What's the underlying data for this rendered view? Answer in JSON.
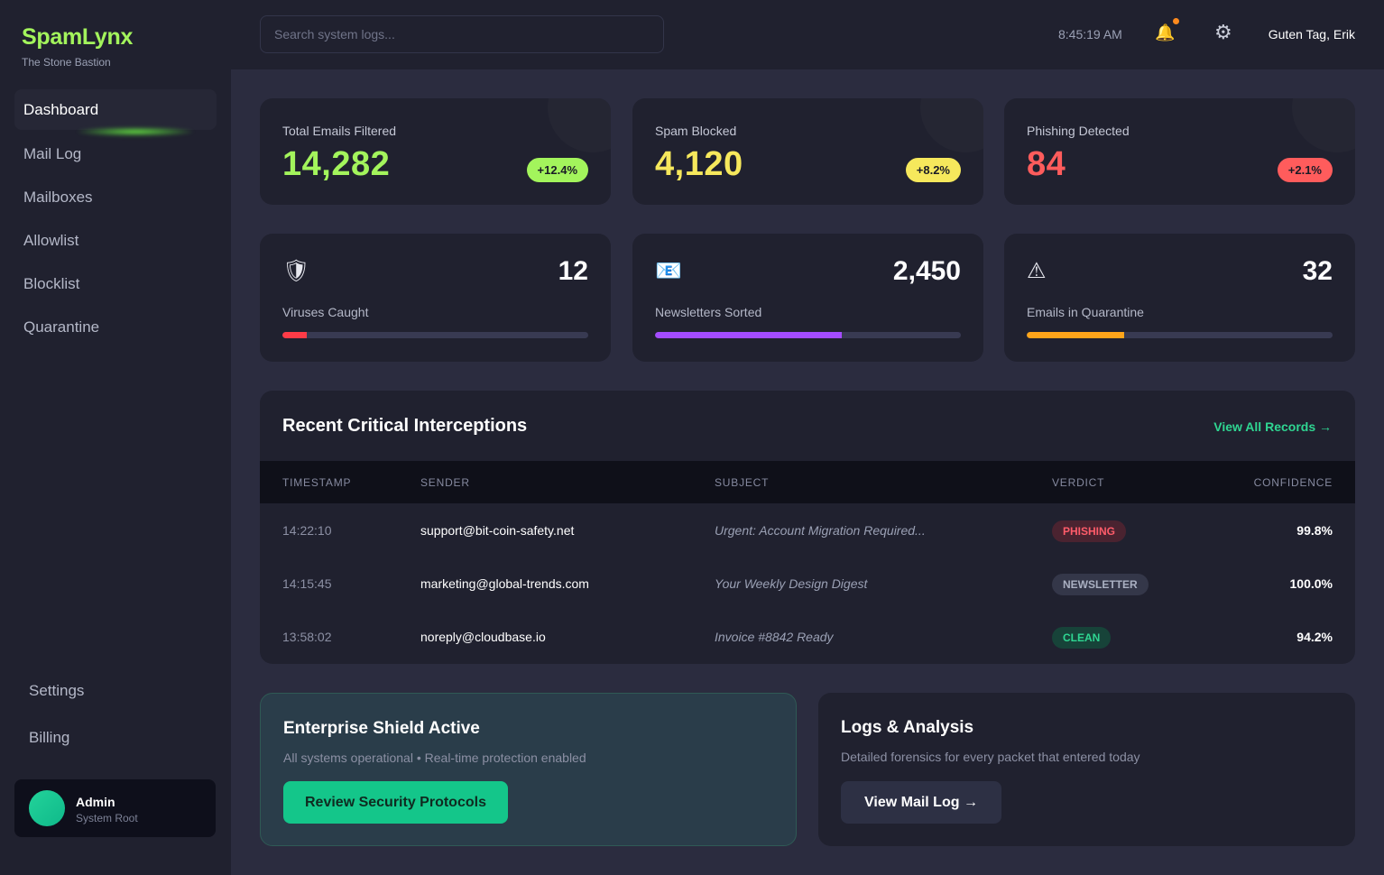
{
  "brand": {
    "name": "SpamLynx",
    "subtitle": "The Stone Bastion"
  },
  "nav": {
    "items": [
      "Dashboard",
      "Mail Log",
      "Mailboxes",
      "Allowlist",
      "Blocklist",
      "Quarantine"
    ],
    "active": "Dashboard",
    "bottom": [
      "Settings",
      "Billing"
    ]
  },
  "user": {
    "name": "Admin",
    "role": "System Root"
  },
  "topbar": {
    "search_placeholder": "Search system logs...",
    "time": "8:45:19 AM",
    "bell_icon": "🔔",
    "gear_icon": "⚙",
    "greeting": "Guten Tag, Erik"
  },
  "stats": [
    {
      "label": "Total Emails Filtered",
      "value": "14,282",
      "badge": "+12.4%",
      "color": "#a3f45c"
    },
    {
      "label": "Spam Blocked",
      "value": "4,120",
      "badge": "+8.2%",
      "color": "#f6e85c"
    },
    {
      "label": "Phishing Detected",
      "value": "84",
      "badge": "+2.1%",
      "color": "#ff5c5c"
    }
  ],
  "mini_stats": [
    {
      "icon": "🛡",
      "icon_name": "shield-icon",
      "value": "12",
      "label": "Viruses Caught",
      "progress": 0.08,
      "color": "#ff3b47"
    },
    {
      "icon": "📧",
      "icon_name": "envelope-icon",
      "value": "2,450",
      "label": "Newsletters Sorted",
      "progress": 0.61,
      "color": "#a44cff"
    },
    {
      "icon": "⚠",
      "icon_name": "warning-icon",
      "value": "32",
      "label": "Emails in Quarantine",
      "progress": 0.32,
      "color": "#ffa51a"
    }
  ],
  "interceptions": {
    "title": "Recent Critical Interceptions",
    "view_all": "View All Records →",
    "columns": [
      "TIMESTAMP",
      "SENDER",
      "SUBJECT",
      "VERDICT",
      "CONFIDENCE"
    ],
    "rows": [
      {
        "timestamp": "14:22:10",
        "sender": "support@bit-coin-safety.net",
        "subject": "Urgent: Account Migration Required...",
        "verdict": "PHISHING",
        "confidence": "99.8%",
        "verdict_fg": "#ff5c6a",
        "verdict_bg": "#4a2330"
      },
      {
        "timestamp": "14:15:45",
        "sender": "marketing@global-trends.com",
        "subject": "Your Weekly Design Digest",
        "verdict": "NEWSLETTER",
        "confidence": "100.0%",
        "verdict_fg": "#aab0c2",
        "verdict_bg": "#343749"
      },
      {
        "timestamp": "13:58:02",
        "sender": "noreply@cloudbase.io",
        "subject": "Invoice #8842 Ready",
        "verdict": "CLEAN",
        "confidence": "94.2%",
        "verdict_fg": "#2fd692",
        "verdict_bg": "#174339"
      }
    ]
  },
  "shield": {
    "title": "Enterprise Shield Active",
    "desc": "All systems operational • Real-time protection enabled",
    "button": "Review Security Protocols"
  },
  "logs": {
    "title": "Logs & Analysis",
    "desc": "Detailed forensics for every packet that entered today",
    "button": "View Mail Log →"
  }
}
